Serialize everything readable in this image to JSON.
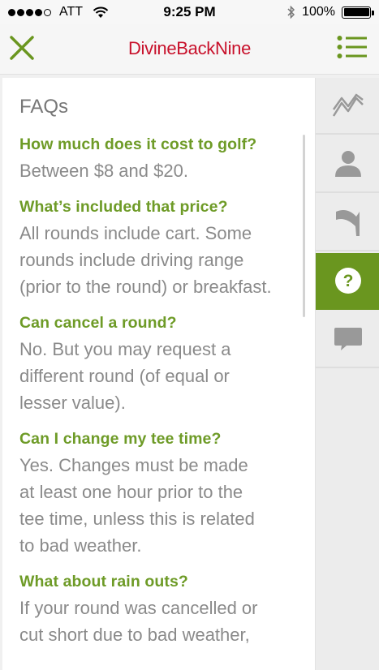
{
  "status_bar": {
    "carrier": "ATT",
    "time": "9:25 PM",
    "battery": "100%"
  },
  "nav": {
    "title": "DivineBackNine"
  },
  "faq": {
    "heading": "FAQs",
    "items": [
      {
        "question": "How much does it cost to golf?",
        "answer_lines": [
          "Between $8 and $20."
        ]
      },
      {
        "question": "What’s included that price?",
        "answer_lines": [
          "All rounds include cart. Some",
          "rounds include driving range",
          "(prior to the round) or breakfast."
        ]
      },
      {
        "question": "Can cancel a round?",
        "answer_lines": [
          "No. But you may request a",
          "different round (of equal or",
          "lesser value)."
        ]
      },
      {
        "question": "Can I change my tee time?",
        "answer_lines": [
          "Yes. Changes must be made",
          "at least one hour prior to the",
          "tee time, unless this is related",
          "to bad weather."
        ]
      },
      {
        "question": "What about rain outs?",
        "answer_lines": [
          "If your round was cancelled or",
          "cut short due to bad weather,"
        ]
      }
    ]
  },
  "sidebar": {
    "items": [
      {
        "icon": "trend-chart-icon",
        "active": false
      },
      {
        "icon": "person-icon",
        "active": false
      },
      {
        "icon": "flag-icon",
        "active": false
      },
      {
        "icon": "question-icon",
        "active": true
      },
      {
        "icon": "chat-bubble-icon",
        "active": false
      }
    ]
  },
  "colors": {
    "accent_green": "#6a961f",
    "title_red": "#c8112b",
    "question_green": "#6e9b27",
    "answer_gray": "#8a8a8a",
    "icon_gray": "#9a9a9a"
  }
}
